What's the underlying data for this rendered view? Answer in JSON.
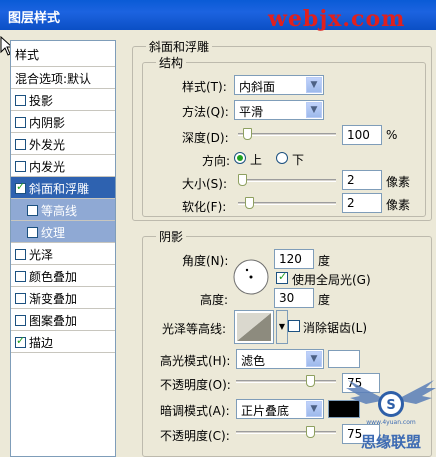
{
  "window": {
    "title": "图层样式"
  },
  "watermark": "webjx.com",
  "left_panel": {
    "header": "样式",
    "blend": "混合选项:默认",
    "items": [
      {
        "label": "投影",
        "checked": false
      },
      {
        "label": "内阴影",
        "checked": false
      },
      {
        "label": "外发光",
        "checked": false
      },
      {
        "label": "内发光",
        "checked": false
      },
      {
        "label": "斜面和浮雕",
        "checked": true
      },
      {
        "label": "等高线",
        "checked": false
      },
      {
        "label": "纹理",
        "checked": false
      },
      {
        "label": "光泽",
        "checked": false
      },
      {
        "label": "颜色叠加",
        "checked": false
      },
      {
        "label": "渐变叠加",
        "checked": false
      },
      {
        "label": "图案叠加",
        "checked": false
      },
      {
        "label": "描边",
        "checked": true
      }
    ]
  },
  "bevel": {
    "group_title": "斜面和浮雕",
    "structure_title": "结构",
    "style_label": "样式(T):",
    "style_value": "内斜面",
    "technique_label": "方法(Q):",
    "technique_value": "平滑",
    "depth_label": "深度(D):",
    "depth_value": "100",
    "depth_unit": "%",
    "direction_label": "方向:",
    "direction_up": "上",
    "direction_down": "下",
    "size_label": "大小(S):",
    "size_value": "2",
    "size_unit": "像素",
    "soften_label": "软化(F):",
    "soften_value": "2",
    "soften_unit": "像素"
  },
  "shading": {
    "title": "阴影",
    "angle_label": "角度(N):",
    "angle_value": "120",
    "angle_unit": "度",
    "global_light_label": "使用全局光(G)",
    "altitude_label": "高度:",
    "altitude_value": "30",
    "altitude_unit": "度",
    "gloss_label": "光泽等高线:",
    "antialias_label": "消除锯齿(L)",
    "highlight_mode_label": "高光模式(H):",
    "highlight_mode_value": "滤色",
    "highlight_opacity_label": "不透明度(O):",
    "highlight_opacity_value": "75",
    "shadow_mode_label": "暗调模式(A):",
    "shadow_mode_value": "正片叠底",
    "shadow_opacity_label": "不透明度(C):",
    "shadow_opacity_value": "75"
  },
  "colors": {
    "highlight_color": "#FFFFFF",
    "shadow_color": "#000000",
    "title_bar": "#0B55D4",
    "selection": "#2E62B0"
  },
  "logo_text": "思缘联盟",
  "logo_url": "www.4yuan.com",
  "icons": [
    "cursor-arrow-icon",
    "radio-icon",
    "checkbox-icon",
    "dropdown-arrow-icon",
    "angle-dial-icon",
    "contour-preview-icon",
    "wings-logo-icon"
  ]
}
